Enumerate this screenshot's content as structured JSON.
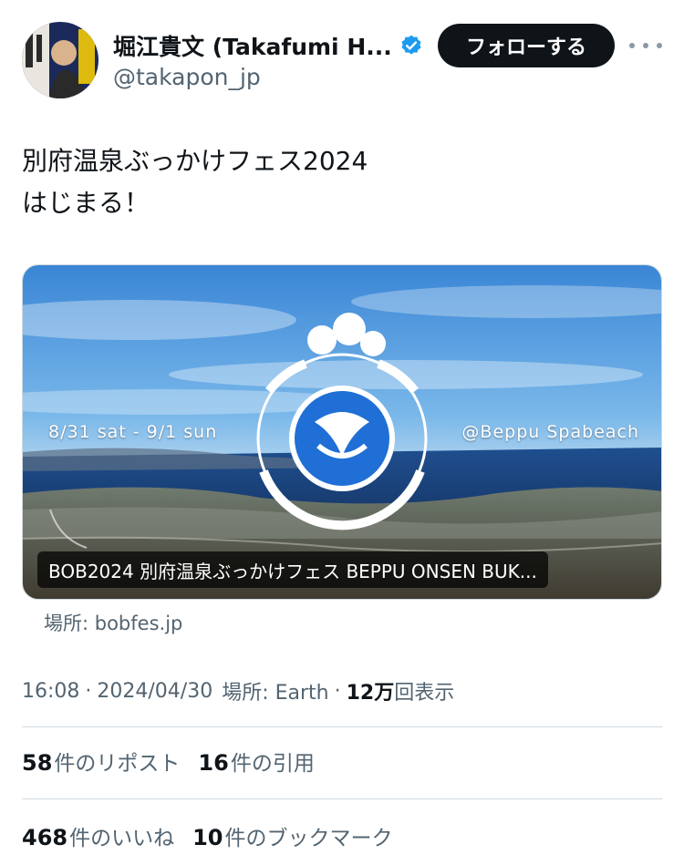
{
  "author": {
    "display_name": "堀江貴文 (Takafumi H...",
    "handle": "@takapon_jp",
    "follow_label": "フォローする",
    "verified_color": "#1d9bf0"
  },
  "tweet": {
    "line1": "別府温泉ぶっかけフェス2024",
    "line2": "はじまる！"
  },
  "card": {
    "date_text": "8/31 sat - 9/1 sun",
    "location_text": "@Beppu Spabeach",
    "caption": "BOB2024 別府温泉ぶっかけフェス BEPPU ONSEN BUK...",
    "domain": "場所: bobfes.jp"
  },
  "meta": {
    "time": "16:08",
    "date": "2024/04/30",
    "place": "場所: Earth",
    "views_count": "12万",
    "views_label": "回表示",
    "dot": "·"
  },
  "stats": {
    "reposts_count": "58",
    "reposts_label": "件のリポスト",
    "quotes_count": "16",
    "quotes_label": "件の引用",
    "likes_count": "468",
    "likes_label": "件のいいね",
    "bookmarks_count": "10",
    "bookmarks_label": "件のブックマーク"
  }
}
